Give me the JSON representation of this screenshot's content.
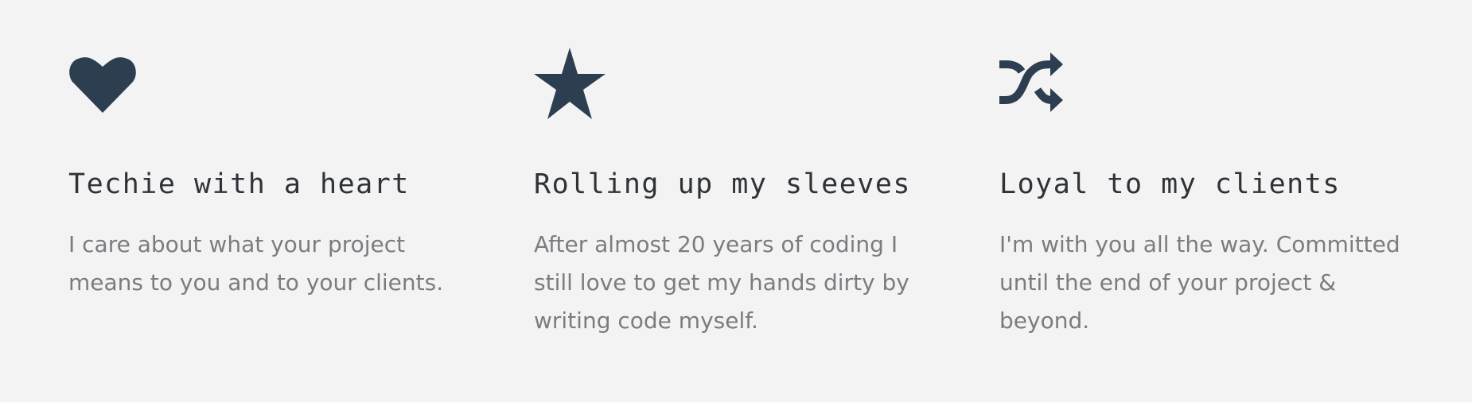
{
  "features": [
    {
      "icon": "heart-icon",
      "title": "Techie with a heart",
      "description": "I care about what your project means to you and to your clients."
    },
    {
      "icon": "star-icon",
      "title": "Rolling up my sleeves",
      "description": "After almost 20 years of coding I still love to get my hands dirty by writing code myself."
    },
    {
      "icon": "shuffle-icon",
      "title": "Loyal to my clients",
      "description": "I'm with you all the way. Committed until the end of your project & beyond."
    }
  ],
  "colors": {
    "background": "#f3f3f3",
    "icon": "#2c3e50",
    "title": "#2f3338",
    "description": "#7a7d80"
  }
}
